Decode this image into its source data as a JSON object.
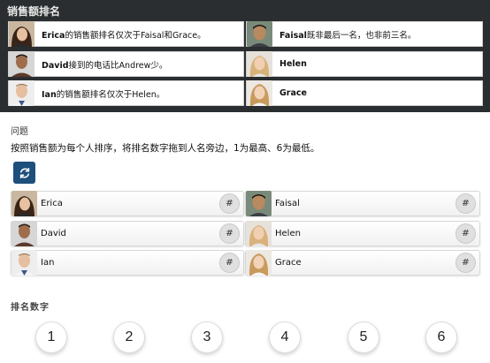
{
  "clues_panel": {
    "title": "销售额排名",
    "clues": [
      {
        "name": "Erica",
        "text": "的销售额排名仅次于Faisal和Grace。",
        "avatar_icon": "erica-avatar-icon"
      },
      {
        "name": "Faisal",
        "text": "既非最后一名，也非前三名。",
        "avatar_icon": "faisal-avatar-icon"
      },
      {
        "name": "David",
        "text": "接到的电话比Andrew少。",
        "avatar_icon": "david-avatar-icon"
      },
      {
        "name": "Helen",
        "text": "",
        "avatar_icon": "helen-avatar-icon"
      },
      {
        "name": "Ian",
        "text": "的销售额排名仅次于Helen。",
        "avatar_icon": "ian-avatar-icon"
      },
      {
        "name": "Grace",
        "text": "",
        "avatar_icon": "grace-avatar-icon"
      }
    ]
  },
  "question": {
    "label": "问题",
    "instructions": "按照销售额为每个人排序，将排名数字拖到人名旁边，1为最高、6为最低。",
    "reset_icon": "refresh-icon"
  },
  "people": [
    {
      "name": "Erica",
      "slot": "#"
    },
    {
      "name": "Faisal",
      "slot": "#"
    },
    {
      "name": "David",
      "slot": "#"
    },
    {
      "name": "Helen",
      "slot": "#"
    },
    {
      "name": "Ian",
      "slot": "#"
    },
    {
      "name": "Grace",
      "slot": "#"
    }
  ],
  "ranks": {
    "label": "排名数字",
    "numbers": [
      "1",
      "2",
      "3",
      "4",
      "5",
      "6"
    ]
  },
  "colors": {
    "panel_bg": "#2b2e30",
    "button_blue": "#1d4f7c"
  }
}
